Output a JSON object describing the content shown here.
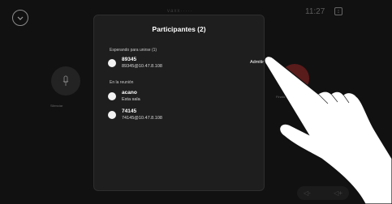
{
  "status": {
    "time": "11:27"
  },
  "background": {
    "top_label": "vaxx·····",
    "mic_label": "Silenciar",
    "right_label": "Finalizar"
  },
  "volume": {
    "down": "◁-",
    "up": "◁+"
  },
  "dialog": {
    "title": "Participantes (2)",
    "waiting_header": "Esperando para unirse (1)",
    "in_meeting_header": "En la reunión",
    "admit_label": "Admitir",
    "waiting": [
      {
        "name": "89345",
        "sub": "89345@10.47.8.108"
      }
    ],
    "participants": [
      {
        "name": "acano",
        "sub": "Esta sala"
      },
      {
        "name": "74145",
        "sub": "74145@10.47.8.108"
      }
    ]
  },
  "colors": {
    "background": "#111111",
    "dialog": "#1e1e1e",
    "avatar": "#f2f2f2",
    "end_call": "#5a1b1b"
  },
  "icons": [
    "chevron-down-icon",
    "microphone-icon",
    "layout-icon",
    "hand-pointer-icon",
    "volume-icon"
  ]
}
